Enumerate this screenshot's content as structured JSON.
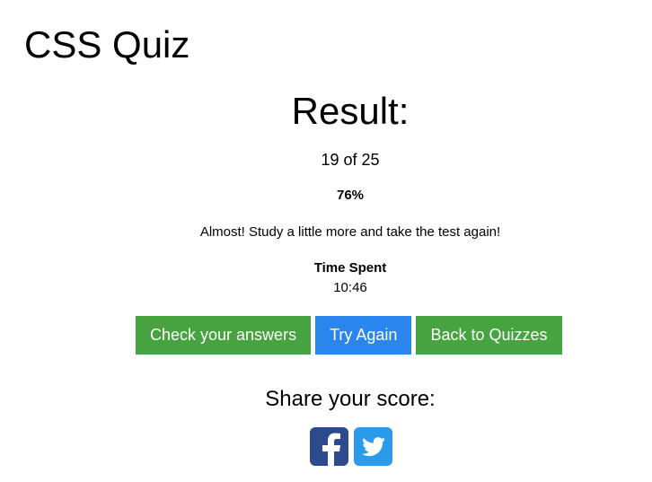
{
  "header": {
    "title": "CSS Quiz"
  },
  "result": {
    "heading": "Result:",
    "score": "19 of 25",
    "percent": "76%",
    "message": "Almost! Study a little more and take the test again!",
    "time_label": "Time Spent",
    "time_value": "10:46"
  },
  "actions": {
    "check_answers_label": "Check your answers",
    "try_again_label": "Try Again",
    "back_label": "Back to Quizzes"
  },
  "share": {
    "heading": "Share your score:",
    "icons": [
      "facebook-icon",
      "twitter-icon"
    ]
  },
  "colors": {
    "green": "#46a340",
    "blue": "#2a86ee",
    "facebook": "#2d4a8c",
    "twitter": "#2a9ae9"
  }
}
